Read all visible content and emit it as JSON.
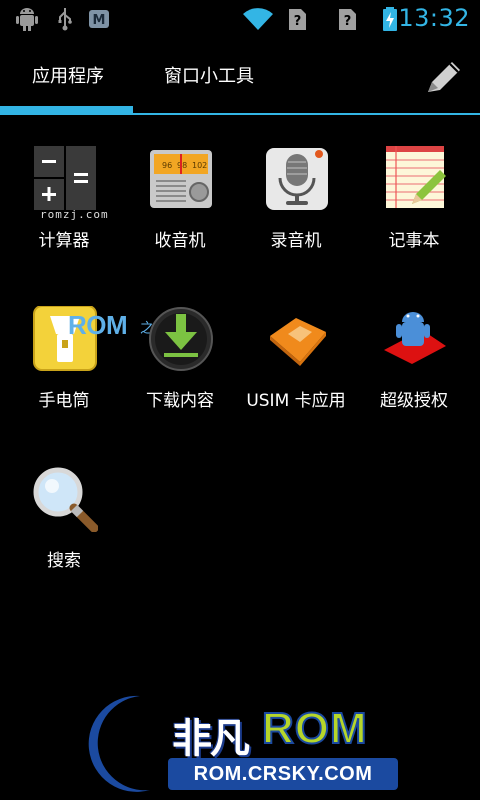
{
  "status_bar": {
    "time": "13:32",
    "accent": "#33b5e5",
    "icons": [
      "android-debug-icon",
      "usb-icon",
      "market-icon",
      "wifi-icon",
      "no-sim-icon",
      "no-sim-icon",
      "battery-charging-icon"
    ]
  },
  "tabs": {
    "apps": "应用程序",
    "widgets": "窗口小工具",
    "action_icon": "pencil-icon"
  },
  "apps": [
    {
      "label": "计算器",
      "icon": "calculator-icon"
    },
    {
      "label": "收音机",
      "icon": "radio-icon"
    },
    {
      "label": "录音机",
      "icon": "microphone-icon"
    },
    {
      "label": "记事本",
      "icon": "notepad-icon"
    },
    {
      "label": "手电筒",
      "icon": "flashlight-icon"
    },
    {
      "label": "下载内容",
      "icon": "download-icon"
    },
    {
      "label": "USIM 卡应用",
      "icon": "sim-card-icon"
    },
    {
      "label": "超级授权",
      "icon": "superuser-icon"
    },
    {
      "label": "搜索",
      "icon": "search-icon"
    }
  ],
  "watermarks": {
    "small": "romzj.com",
    "rom": "ROM",
    "rom_suffix": "之家"
  },
  "logo": {
    "cn": "非凡",
    "rom": "ROM",
    "url": "ROM.CRSKY.COM"
  },
  "colors": {
    "accent": "#33b5e5",
    "background": "#000000",
    "logo_green": "#b6d62a",
    "logo_blue": "#1b4aa0"
  }
}
